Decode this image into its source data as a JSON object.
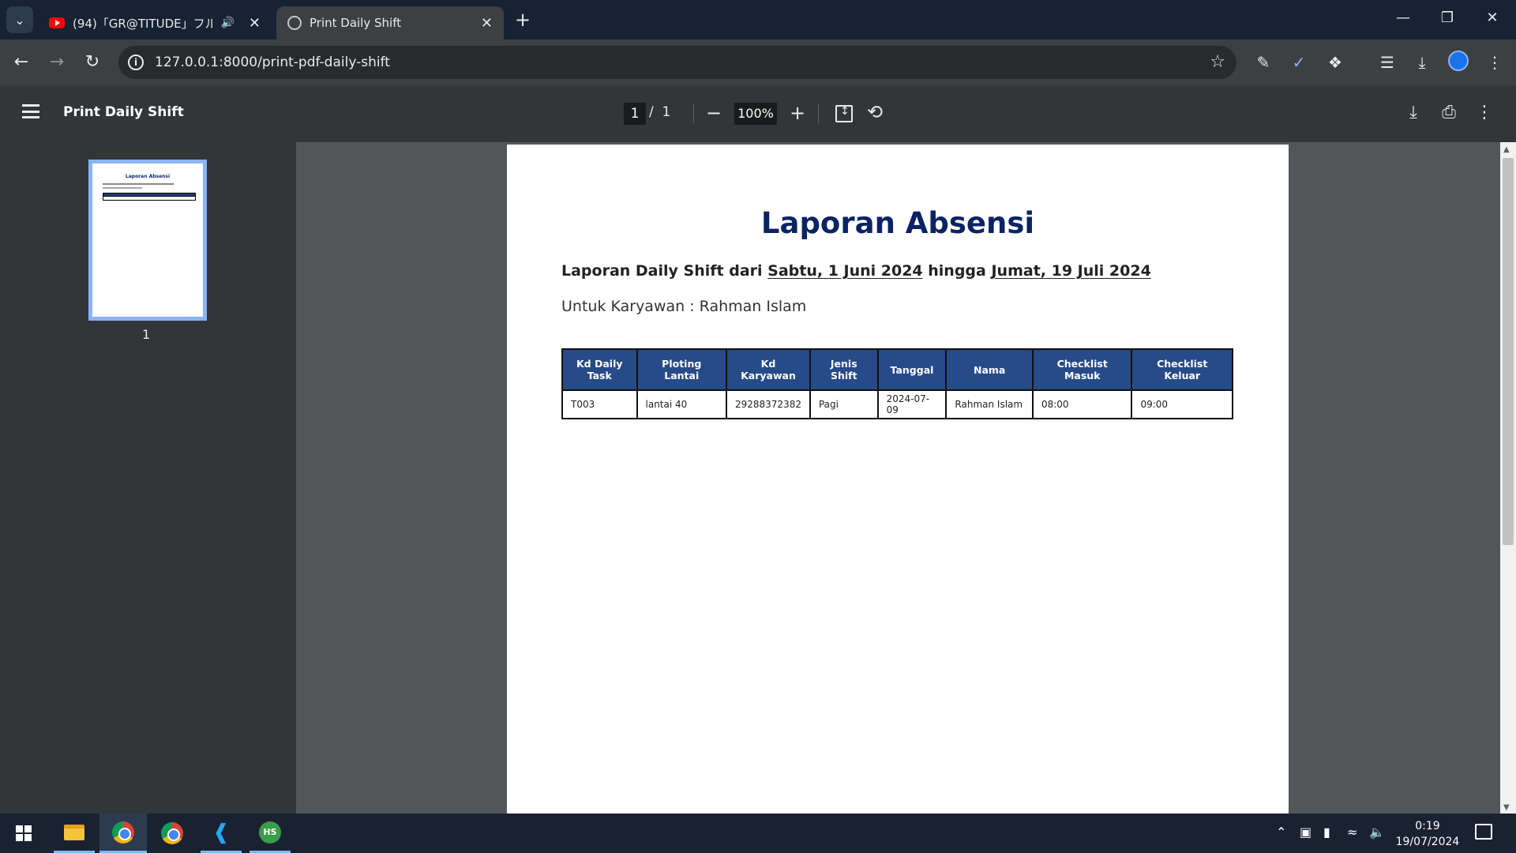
{
  "browser": {
    "tabs": [
      {
        "title": "(94)「GR@TITUDE」フルコーラ",
        "favicon": "youtube-icon"
      },
      {
        "title": "Print Daily Shift",
        "favicon": "globe-icon"
      }
    ],
    "new_tab": "+",
    "url": "127.0.0.1:8000/print-pdf-daily-shift"
  },
  "pdf_viewer": {
    "title": "Print Daily Shift",
    "current_page": "1",
    "page_separator": "/",
    "total_pages": "1",
    "zoom": "100%",
    "thumbnail_page_label": "1"
  },
  "document": {
    "title": "Laporan Absensi",
    "subtitle_prefix": "Laporan Daily Shift dari ",
    "date_from": "Sabtu, 1 Juni 2024",
    "subtitle_middle": " hingga ",
    "date_to": "Jumat, 19 Juli 2024",
    "employee_line": "Untuk Karyawan : Rahman Islam",
    "table": {
      "headers": [
        "Kd Daily Task",
        "Ploting Lantai",
        "Kd Karyawan",
        "Jenis Shift",
        "Tanggal",
        "Nama",
        "Checklist Masuk",
        "Checklist Keluar"
      ],
      "rows": [
        [
          "T003",
          "lantai 40",
          "29288372382",
          "Pagi",
          "2024-07-09",
          "Rahman Islam",
          "08:00",
          "09:00"
        ]
      ]
    }
  },
  "taskbar": {
    "time": "0:19",
    "date": "19/07/2024"
  },
  "colors": {
    "title_blue": "#0a2463",
    "table_header": "#274a88",
    "thumbnail_border": "#8ab4f8"
  }
}
